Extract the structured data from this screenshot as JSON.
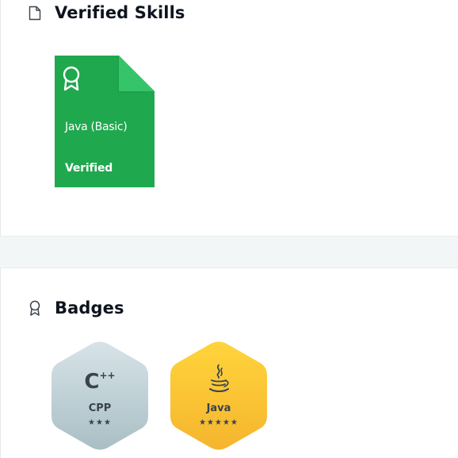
{
  "verified_skills": {
    "title": "Verified Skills",
    "icon": "document-icon",
    "skills": [
      {
        "name": "Java (Basic)",
        "status": "Verified",
        "icon": "ribbon-award-icon",
        "color": "#20a84e",
        "fold_color": "#36c46a"
      }
    ]
  },
  "badges": {
    "title": "Badges",
    "icon": "ribbon-award-icon",
    "items": [
      {
        "name": "CPP",
        "stars": "★★★",
        "star_count": 3,
        "logo_text": "C",
        "logo_sup": "++",
        "color_top": "#d7e3e8",
        "color_bottom": "#a9bfc4"
      },
      {
        "name": "Java",
        "stars": "★★★★★",
        "star_count": 5,
        "logo": "java-cup-icon",
        "color_top": "#ffd43b",
        "color_bottom": "#f7b731"
      }
    ]
  }
}
